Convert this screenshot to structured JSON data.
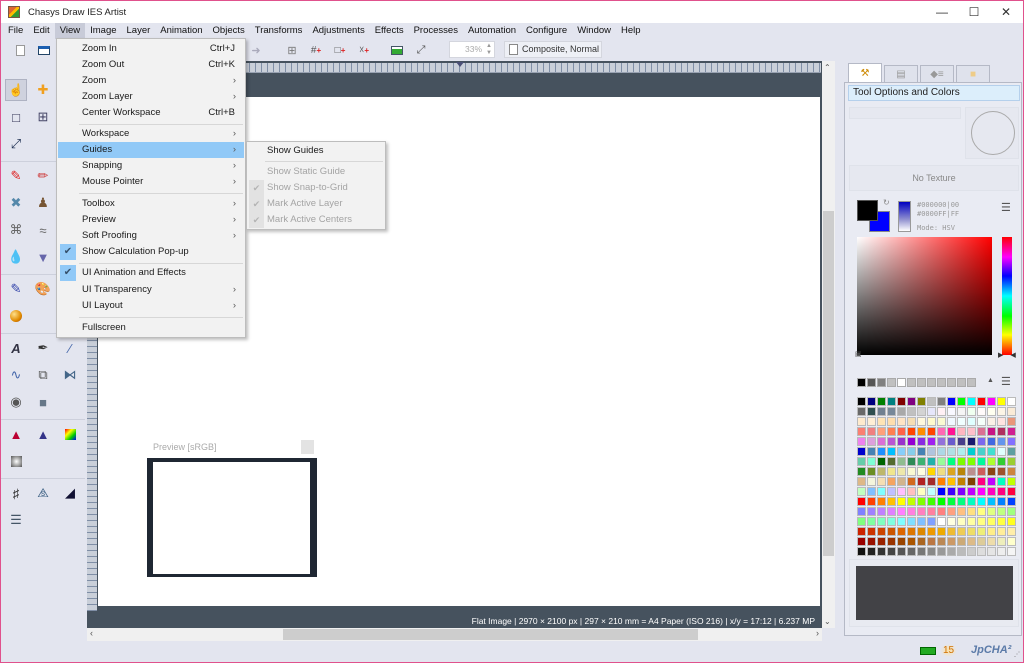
{
  "window": {
    "title": "Chasys Draw IES Artist",
    "controls": [
      "minimize",
      "maximize",
      "close"
    ]
  },
  "menubar": {
    "items": [
      "File",
      "Edit",
      "View",
      "Image",
      "Layer",
      "Animation",
      "Objects",
      "Transforms",
      "Adjustments",
      "Effects",
      "Processes",
      "Automation",
      "Configure",
      "Window",
      "Help"
    ],
    "active": "View"
  },
  "toolbar": {
    "zoom_value": "33%",
    "composite_label": "Composite, Normal",
    "icons": [
      "new-document-icon",
      "window-icon",
      "redo-icon",
      "crop-canvas-icon",
      "grid-add-icon",
      "frame-add-icon",
      "layer-add-icon",
      "image-icon",
      "fit-screen-icon"
    ]
  },
  "view_menu": {
    "items": [
      {
        "label": "Zoom In",
        "shortcut": "Ctrl+J"
      },
      {
        "label": "Zoom Out",
        "shortcut": "Ctrl+K"
      },
      {
        "label": "Zoom",
        "submenu": true
      },
      {
        "label": "Zoom Layer",
        "submenu": true
      },
      {
        "label": "Center Workspace",
        "shortcut": "Ctrl+B"
      },
      {
        "label": "Workspace",
        "submenu": true
      },
      {
        "label": "Guides",
        "submenu": true,
        "highlighted": true
      },
      {
        "label": "Snapping",
        "submenu": true
      },
      {
        "label": "Mouse Pointer",
        "submenu": true
      },
      {
        "label": "Toolbox",
        "submenu": true
      },
      {
        "label": "Preview",
        "submenu": true
      },
      {
        "label": "Soft Proofing",
        "submenu": true
      },
      {
        "label": "Show Calculation Pop-up",
        "checked": true
      },
      {
        "label": "UI Animation and Effects",
        "checked": true
      },
      {
        "label": "UI Transparency",
        "submenu": true
      },
      {
        "label": "UI Layout",
        "submenu": true
      },
      {
        "label": "Fullscreen"
      }
    ]
  },
  "guides_submenu": {
    "items": [
      {
        "label": "Show Guides",
        "enabled": true
      },
      {
        "label": "Show Static Guide",
        "enabled": false
      },
      {
        "label": "Show Snap-to-Grid",
        "enabled": false,
        "checked": true
      },
      {
        "label": "Mark Active Layer",
        "enabled": false,
        "checked": true
      },
      {
        "label": "Mark Active Centers",
        "enabled": false,
        "checked": true
      }
    ]
  },
  "canvas": {
    "status_text": "Flat Image | 2970 × 2100 px | 297 × 210 mm = A4 Paper (ISO 216) | x/y = 17:12 | 6.237 MP"
  },
  "preview_window": {
    "title": "Preview [sRGB]"
  },
  "right_panel": {
    "tabs": [
      "tool-options-tab",
      "layers-tab",
      "properties-tab",
      "files-tab"
    ],
    "header": "Tool Options and Colors",
    "no_texture_label": "No Texture",
    "primary_color": "#000000",
    "secondary_color": "#0000FF",
    "primary_hex": "#000000|00",
    "secondary_hex": "#0000FF|FF",
    "mode_label": "Mode: HSV"
  },
  "statusbar": {
    "memory_count": "15",
    "brand": "JpCHA²"
  },
  "palette_top": [
    "#000000",
    "#555555",
    "#808080",
    "#c0c0c0",
    "#ffffff",
    "#c0c0c0",
    "#c0c0c0",
    "#c0c0c0",
    "#c0c0c0",
    "#c0c0c0",
    "#c0c0c0",
    "#c0c0c0"
  ],
  "palette": [
    "#000000",
    "#000080",
    "#008000",
    "#008080",
    "#800000",
    "#800080",
    "#808000",
    "#c0c0c0",
    "#808080",
    "#0000ff",
    "#00ff00",
    "#00ffff",
    "#ff0000",
    "#ff00ff",
    "#ffff00",
    "#ffffff",
    "#696969",
    "#2f4f4f",
    "#708090",
    "#778899",
    "#a9a9a9",
    "#c0c0c0",
    "#d3d3d3",
    "#e6e6fa",
    "#fff0f5",
    "#f8f8ff",
    "#f5f5f5",
    "#f0fff0",
    "#fffafa",
    "#fffff0",
    "#fdf5e6",
    "#faebd7",
    "#ffebcd",
    "#ffefd5",
    "#ffe4b5",
    "#ffdead",
    "#ffe4c4",
    "#f5deb3",
    "#fff8dc",
    "#fffacd",
    "#fafad2",
    "#f0f8ff",
    "#f0ffff",
    "#e0ffff",
    "#f5fffa",
    "#faf0e6",
    "#ffe4e1",
    "#e9967a",
    "#fa8072",
    "#f08080",
    "#ffa07a",
    "#ff7f50",
    "#ff6347",
    "#ff4500",
    "#ff8c00",
    "#ff4500",
    "#ff69b4",
    "#ff1493",
    "#ffb6c1",
    "#ffc0cb",
    "#db7093",
    "#c71585",
    "#b03060",
    "#d02090",
    "#ee82ee",
    "#dda0dd",
    "#da70d6",
    "#ba55d3",
    "#9932cc",
    "#9400d3",
    "#8a2be2",
    "#a020f0",
    "#9370db",
    "#6a5acd",
    "#483d8b",
    "#191970",
    "#7b68ee",
    "#4169e1",
    "#6495ed",
    "#8470ff",
    "#0000cd",
    "#4682b4",
    "#1e90ff",
    "#00bfff",
    "#87cefa",
    "#87ceeb",
    "#4682b4",
    "#b0c4de",
    "#add8e6",
    "#b0e0e6",
    "#afeeee",
    "#00ced1",
    "#48d1cc",
    "#40e0d0",
    "#e0ffff",
    "#5f9ea0",
    "#66cdaa",
    "#7fffd4",
    "#006400",
    "#556b2f",
    "#8fbc8f",
    "#2e8b57",
    "#3cb371",
    "#20b2aa",
    "#98fb98",
    "#00ff7f",
    "#7cfc00",
    "#7fff00",
    "#00fa9a",
    "#adff2f",
    "#32cd32",
    "#9acd32",
    "#228b22",
    "#6b8e23",
    "#bdb76b",
    "#f0e68c",
    "#eee8aa",
    "#fafad2",
    "#ffffe0",
    "#ffd700",
    "#eedd82",
    "#daa520",
    "#b8860b",
    "#bc8f8f",
    "#cd5c5c",
    "#8b4513",
    "#a0522d",
    "#cd853f",
    "#deb887",
    "#f5f5dc",
    "#f5deb3",
    "#f4a460",
    "#d2b48c",
    "#d2691e",
    "#b22222",
    "#a52a2a",
    "#ff8000",
    "#ffc000",
    "#c08000",
    "#804000",
    "#ff0080",
    "#c000ff",
    "#00ffc0",
    "#c0ff00",
    "#c0ffc0",
    "#80c0ff",
    "#80ffff",
    "#c0c0ff",
    "#ffc0ff",
    "#ffc0c0",
    "#ffffc0",
    "#c0ffff",
    "#0000ff",
    "#4000ff",
    "#8000ff",
    "#c000ff",
    "#ff00ff",
    "#ff00c0",
    "#ff0080",
    "#ff0040",
    "#ff0000",
    "#ff4000",
    "#ff8000",
    "#ffc000",
    "#ffff00",
    "#c0ff00",
    "#80ff00",
    "#40ff00",
    "#00ff00",
    "#00ff40",
    "#00ff80",
    "#00ffc0",
    "#00ffff",
    "#00c0ff",
    "#0080ff",
    "#0040ff",
    "#8080ff",
    "#a080ff",
    "#c080ff",
    "#e080ff",
    "#ff80ff",
    "#ff80e0",
    "#ff80c0",
    "#ff80a0",
    "#ff8080",
    "#ffa080",
    "#ffc080",
    "#ffe080",
    "#ffff80",
    "#e0ff80",
    "#c0ff80",
    "#a0ff80",
    "#80ff80",
    "#80ffa0",
    "#80ffc0",
    "#80ffe0",
    "#80ffff",
    "#80e0ff",
    "#80c0ff",
    "#80a0ff",
    "#ffffff",
    "#ffffe0",
    "#ffffc0",
    "#ffffa0",
    "#ffff80",
    "#ffff60",
    "#ffff40",
    "#ffff20",
    "#cc2200",
    "#cc3300",
    "#cc4400",
    "#cc5500",
    "#dd6600",
    "#dd7700",
    "#dd8800",
    "#ee9900",
    "#eeaa00",
    "#eebb33",
    "#eecc55",
    "#eedd66",
    "#eeee77",
    "#ffee88",
    "#ffee99",
    "#ffeeaa",
    "#990000",
    "#991100",
    "#992200",
    "#993300",
    "#994400",
    "#aa5500",
    "#aa6622",
    "#bb7744",
    "#bb8855",
    "#cc9966",
    "#ccaa77",
    "#ddbb88",
    "#ddcc99",
    "#eeddaa",
    "#eeeebb",
    "#ffffcc",
    "#111111",
    "#222222",
    "#333333",
    "#444444",
    "#555555",
    "#666666",
    "#777777",
    "#888888",
    "#999999",
    "#aaaaaa",
    "#bbbbbb",
    "#cccccc",
    "#dddddd",
    "#e5e5e5",
    "#eeeeee",
    "#f5f5f5"
  ]
}
